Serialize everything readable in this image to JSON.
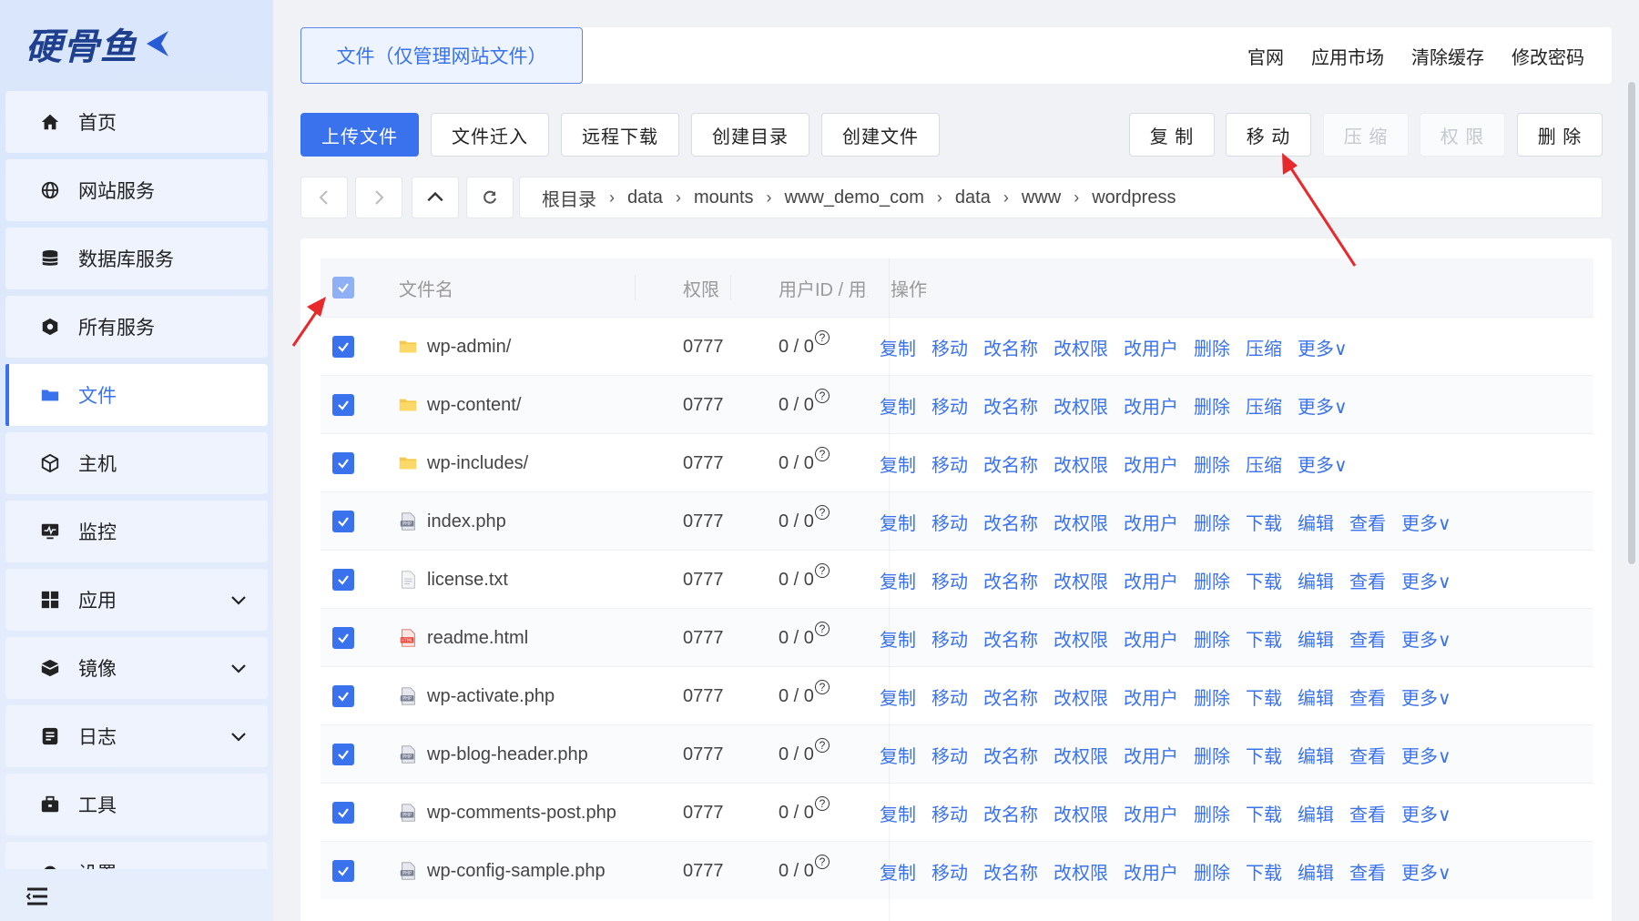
{
  "app": {
    "logo_text": "硬骨鱼"
  },
  "sidebar": {
    "items": [
      {
        "label": "首页",
        "icon": "home-icon"
      },
      {
        "label": "网站服务",
        "icon": "globe-icon"
      },
      {
        "label": "数据库服务",
        "icon": "database-icon"
      },
      {
        "label": "所有服务",
        "icon": "services-icon"
      },
      {
        "label": "文件",
        "icon": "folder-icon",
        "active": true
      },
      {
        "label": "主机",
        "icon": "host-icon"
      },
      {
        "label": "监控",
        "icon": "monitor-icon"
      },
      {
        "label": "应用",
        "icon": "apps-icon",
        "expandable": true
      },
      {
        "label": "镜像",
        "icon": "image-icon",
        "expandable": true
      },
      {
        "label": "日志",
        "icon": "log-icon",
        "expandable": true
      },
      {
        "label": "工具",
        "icon": "toolbox-icon"
      },
      {
        "label": "设置",
        "icon": "settings-icon"
      }
    ]
  },
  "header": {
    "tab_label": "文件（仅管理网站文件）",
    "links": [
      "官网",
      "应用市场",
      "清除缓存",
      "修改密码"
    ]
  },
  "toolbar": {
    "left_buttons": [
      "上传文件",
      "文件迁入",
      "远程下载",
      "创建目录",
      "创建文件"
    ],
    "right_buttons": [
      {
        "label": "复 制",
        "disabled": false
      },
      {
        "label": "移 动",
        "disabled": false
      },
      {
        "label": "压 缩",
        "disabled": true
      },
      {
        "label": "权 限",
        "disabled": true
      },
      {
        "label": "删 除",
        "disabled": false
      }
    ]
  },
  "path": {
    "crumbs": [
      "根目录",
      "data",
      "mounts",
      "www_demo_com",
      "data",
      "www",
      "wordpress"
    ]
  },
  "table": {
    "headers": {
      "name": "文件名",
      "perm": "权限",
      "user": "用户ID / 用户",
      "ops": "操作"
    },
    "dir_ops": [
      "复制",
      "移动",
      "改名称",
      "改权限",
      "改用户",
      "删除",
      "压缩",
      "更多∨"
    ],
    "file_ops": [
      "复制",
      "移动",
      "改名称",
      "改权限",
      "改用户",
      "删除",
      "下载",
      "编辑",
      "查看",
      "更多∨"
    ],
    "rows": [
      {
        "name": "wp-admin/",
        "type": "dir",
        "perm": "0777",
        "user": "0 / 0"
      },
      {
        "name": "wp-content/",
        "type": "dir",
        "perm": "0777",
        "user": "0 / 0"
      },
      {
        "name": "wp-includes/",
        "type": "dir",
        "perm": "0777",
        "user": "0 / 0"
      },
      {
        "name": "index.php",
        "type": "php",
        "perm": "0777",
        "user": "0 / 0"
      },
      {
        "name": "license.txt",
        "type": "txt",
        "perm": "0777",
        "user": "0 / 0"
      },
      {
        "name": "readme.html",
        "type": "html",
        "perm": "0777",
        "user": "0 / 0"
      },
      {
        "name": "wp-activate.php",
        "type": "php",
        "perm": "0777",
        "user": "0 / 0"
      },
      {
        "name": "wp-blog-header.php",
        "type": "php",
        "perm": "0777",
        "user": "0 / 0"
      },
      {
        "name": "wp-comments-post.php",
        "type": "php",
        "perm": "0777",
        "user": "0 / 0"
      },
      {
        "name": "wp-config-sample.php",
        "type": "php",
        "perm": "0777",
        "user": "0 / 0"
      }
    ]
  },
  "colors": {
    "accent": "#3a72ee",
    "annotation_arrow": "#e8292c"
  }
}
